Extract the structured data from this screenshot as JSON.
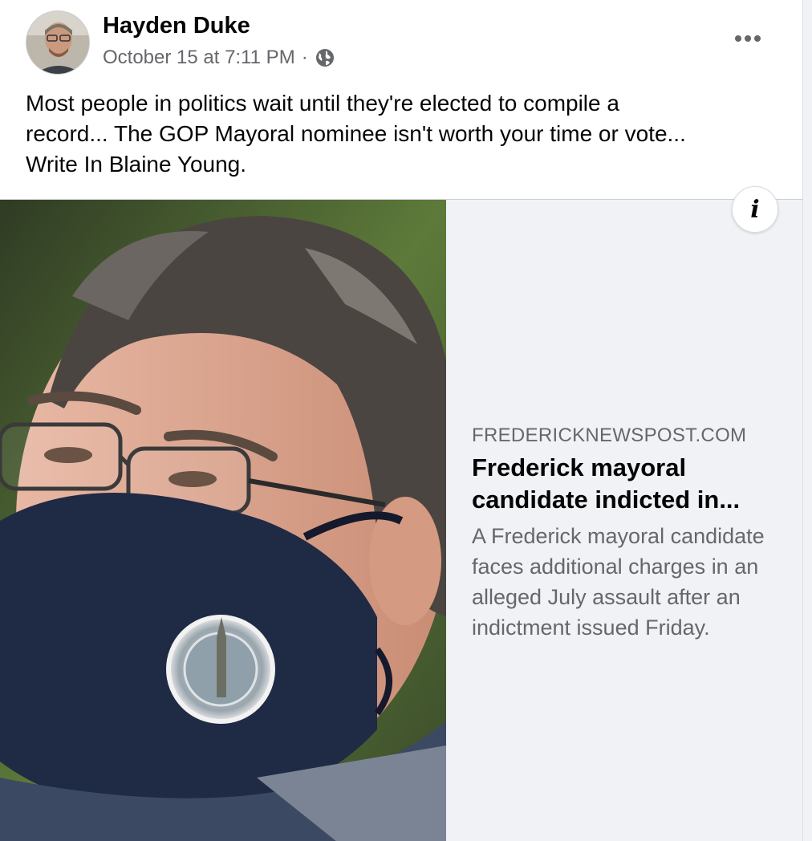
{
  "post": {
    "author": "Hayden Duke",
    "timestamp": "October 15 at 7:11 PM",
    "separator": "·",
    "audience_icon": "globe-icon",
    "more_icon": "more-options-icon",
    "message_lines": [
      "Most people in politics wait until they're elected to compile a",
      "record... The GOP Mayoral nominee isn't worth your time or vote...",
      "Write In Blaine Young."
    ]
  },
  "link_card": {
    "domain": "FREDERICKNEWSPOST.COM",
    "title": "Frederick mayoral candidate indicted in...",
    "description": "A Frederick mayoral candidate faces additional charges in an alleged July assault after an indictment issued Friday.",
    "info_icon": "info-icon",
    "info_glyph": "i",
    "image_alt": "Man with curly gray hair, glasses and a navy face mask with a city seal"
  },
  "colors": {
    "text_primary": "#050505",
    "text_secondary": "#65676b",
    "card_background": "#f0f2f5",
    "post_background": "#ffffff",
    "mask_navy": "#1f2a44"
  }
}
